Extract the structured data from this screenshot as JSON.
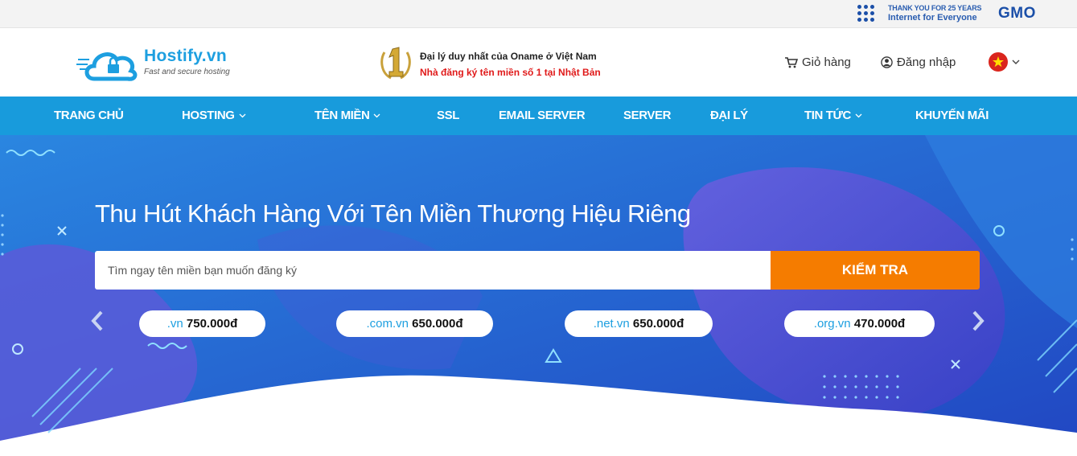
{
  "gmo": {
    "thanks": "THANK YOU FOR 25 YEARS",
    "tagline": "Internet for Everyone",
    "logo": "GMO"
  },
  "header": {
    "brand": "Hostify.vn",
    "slogan": "Fast and secure hosting",
    "agency_line1": "Đại lý duy nhất của Oname ở Việt Nam",
    "agency_line2": "Nhà đăng ký tên miền số 1 tại Nhật Bản",
    "cart_label": "Giỏ hàng",
    "login_label": "Đăng nhập",
    "language_flag": "vietnam-flag-icon",
    "medal_icon": "number-one-medal-icon"
  },
  "nav": {
    "items": [
      {
        "label": "TRANG CHỦ",
        "dropdown": false
      },
      {
        "label": "HOSTING",
        "dropdown": true
      },
      {
        "label": "TÊN MIỀN",
        "dropdown": true
      },
      {
        "label": "SSL",
        "dropdown": false
      },
      {
        "label": "EMAIL SERVER",
        "dropdown": false
      },
      {
        "label": "SERVER",
        "dropdown": false
      },
      {
        "label": "ĐẠI LÝ",
        "dropdown": false
      },
      {
        "label": "TIN TỨC",
        "dropdown": true
      },
      {
        "label": "KHUYẾN MÃI",
        "dropdown": false
      }
    ]
  },
  "hero": {
    "title": "Thu Hút Khách Hàng Với Tên Miền Thương Hiệu Riêng",
    "search_placeholder": "Tìm ngay tên miền bạn muốn đăng ký",
    "search_value": "",
    "search_button": "KIỂM TRA",
    "prices": [
      {
        "tld": ".vn",
        "amount": "750.000đ"
      },
      {
        "tld": ".com.vn",
        "amount": "650.000đ"
      },
      {
        "tld": ".net.vn",
        "amount": "650.000đ"
      },
      {
        "tld": ".org.vn",
        "amount": "470.000đ"
      }
    ]
  },
  "colors": {
    "brand_blue": "#1d9fe0",
    "nav_blue": "#189bdc",
    "hero_blue": "#1d5cc9",
    "cta_orange": "#f57c00",
    "alert_red": "#e01a1a"
  }
}
